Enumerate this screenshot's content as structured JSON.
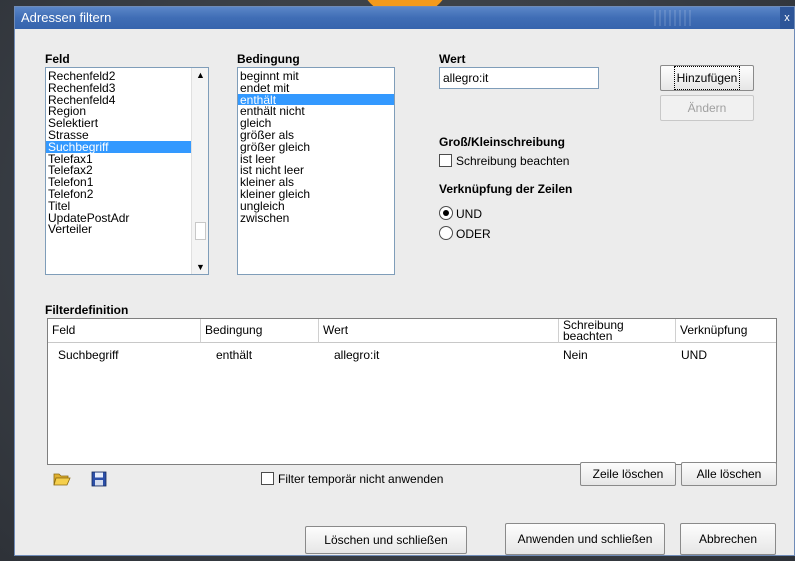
{
  "window": {
    "title": "Adressen filtern",
    "close_glyph": "x"
  },
  "feld": {
    "label": "Feld",
    "items": [
      "Rechenfeld2",
      "Rechenfeld3",
      "Rechenfeld4",
      "Region",
      "Selektiert",
      "Strasse",
      "Suchbegriff",
      "Telefax1",
      "Telefax2",
      "Telefon1",
      "Telefon2",
      "Titel",
      "UpdatePostAdr",
      "Verteiler"
    ],
    "selected_index": 6
  },
  "bedingung": {
    "label": "Bedingung",
    "items": [
      "beginnt mit",
      "endet mit",
      "enthält",
      "enthält nicht",
      "gleich",
      "größer als",
      "größer gleich",
      "ist leer",
      "ist nicht leer",
      "kleiner als",
      "kleiner gleich",
      "ungleich",
      "zwischen"
    ],
    "selected_index": 2
  },
  "wert": {
    "label": "Wert",
    "value": "allegro:it"
  },
  "buttons": {
    "add": "Hinzufügen",
    "change": "Ändern",
    "delete_row": "Zeile löschen",
    "delete_all": "Alle löschen",
    "delete_close": "Löschen und schließen",
    "apply_close": "Anwenden und schließen",
    "cancel": "Abbrechen"
  },
  "case": {
    "heading": "Groß/Kleinschreibung",
    "checkbox_label": "Schreibung beachten",
    "checked": false
  },
  "link": {
    "heading": "Verknüpfung der Zeilen",
    "option_und": "UND",
    "option_oder": "ODER",
    "selected": "UND"
  },
  "filter": {
    "heading": "Filterdefinition",
    "columns": [
      "Feld",
      "Bedingung",
      "Wert",
      "Schreibung beachten",
      "Verknüpfung"
    ],
    "rows": [
      [
        "Suchbegriff",
        "enthält",
        "allegro:it",
        "Nein",
        "UND"
      ]
    ],
    "temp_checkbox_label": "Filter temporär nicht anwenden",
    "temp_checked": false
  },
  "icons": {
    "open": "folder-open-icon",
    "save": "floppy-disk-icon"
  },
  "colors": {
    "selection": "#3399ff",
    "titlebar": "#3f6db5",
    "dialog_bg": "#ececec"
  }
}
